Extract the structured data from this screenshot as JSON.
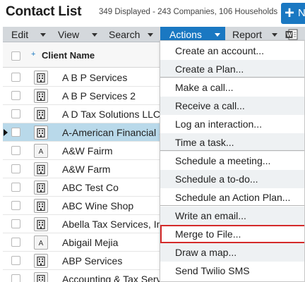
{
  "header": {
    "title": "Contact List",
    "subtitle": "349 Displayed - 243 Companies, 106 Households",
    "new_button_plus": "+",
    "new_button_label": "N"
  },
  "menubar": {
    "items": [
      {
        "label": "Edit"
      },
      {
        "label": "View"
      },
      {
        "label": "Search"
      },
      {
        "label": "Actions"
      },
      {
        "label": "Report"
      }
    ],
    "active": "Actions",
    "export_icon": "word-icon"
  },
  "grid": {
    "sort_icon": "+",
    "column_header": "Client Name",
    "rows": [
      {
        "name": "A B P Services",
        "type": "company"
      },
      {
        "name": "A B P Services 2",
        "type": "company"
      },
      {
        "name": "A D Tax Solutions LLC",
        "type": "company"
      },
      {
        "name": "A-American Financial S",
        "type": "company",
        "selected": true
      },
      {
        "name": "A&W Fairm",
        "type": "household",
        "letter": "A"
      },
      {
        "name": "A&W Farm",
        "type": "company"
      },
      {
        "name": "ABC Test Co",
        "type": "company"
      },
      {
        "name": "ABC Wine Shop",
        "type": "company"
      },
      {
        "name": "Abella Tax Services, Inc",
        "type": "company"
      },
      {
        "name": "Abigail Mejia",
        "type": "household",
        "letter": "A"
      },
      {
        "name": "ABP Services",
        "type": "company"
      },
      {
        "name": "Accounting & Tax Services LLC",
        "type": "company"
      }
    ]
  },
  "actions_menu": {
    "items": [
      "Create an account...",
      "Create a Plan...",
      "Make a call...",
      "Receive a call...",
      "Log an interaction...",
      "Time a task...",
      "Schedule a meeting...",
      "Schedule a to-do...",
      "Schedule an Action Plan...",
      "Write an email...",
      "Merge to File...",
      "Draw a map...",
      "Send Twilio SMS"
    ],
    "highlighted": "Merge to File..."
  },
  "colors": {
    "accent": "#1a78c2",
    "menubar": "#d4d8dc",
    "selected_row": "#b9d9ea",
    "highlight_border": "#d42a2a"
  }
}
